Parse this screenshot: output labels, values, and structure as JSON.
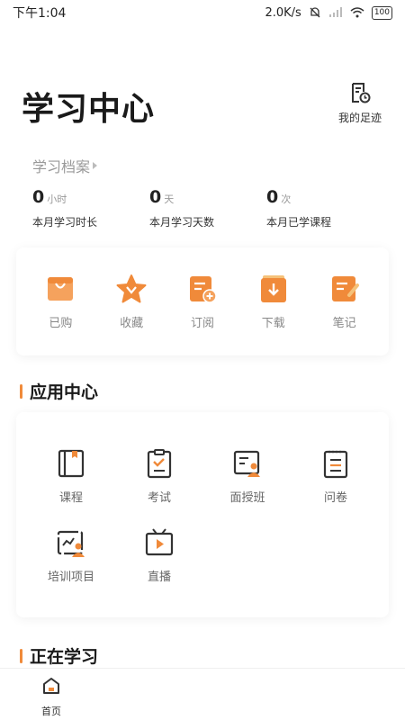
{
  "status_bar": {
    "time": "下午1:04",
    "net_speed": "2.0K/s",
    "battery": "100"
  },
  "header": {
    "title": "学习中心",
    "footprint_label": "我的足迹"
  },
  "profile": {
    "link_label": "学习档案",
    "stats": [
      {
        "value": "0",
        "unit": "小时",
        "label": "本月学习时长"
      },
      {
        "value": "0",
        "unit": "天",
        "label": "本月学习天数"
      },
      {
        "value": "0",
        "unit": "次",
        "label": "本月已学课程"
      }
    ]
  },
  "quick_actions": [
    {
      "label": "已购",
      "icon": "bag-icon"
    },
    {
      "label": "收藏",
      "icon": "star-icon"
    },
    {
      "label": "订阅",
      "icon": "subscribe-icon"
    },
    {
      "label": "下载",
      "icon": "download-icon"
    },
    {
      "label": "笔记",
      "icon": "note-icon"
    }
  ],
  "app_center": {
    "title": "应用中心",
    "items": [
      {
        "label": "课程",
        "icon": "course-book-icon"
      },
      {
        "label": "考试",
        "icon": "exam-clipboard-icon"
      },
      {
        "label": "面授班",
        "icon": "classroom-icon"
      },
      {
        "label": "问卷",
        "icon": "survey-icon"
      },
      {
        "label": "培训项目",
        "icon": "training-project-icon"
      },
      {
        "label": "直播",
        "icon": "live-tv-icon"
      }
    ]
  },
  "learning_now": {
    "title": "正在学习"
  },
  "bottom_nav": {
    "home_label": "首页"
  },
  "colors": {
    "accent": "#f08a3a",
    "icon_dark": "#333333"
  }
}
